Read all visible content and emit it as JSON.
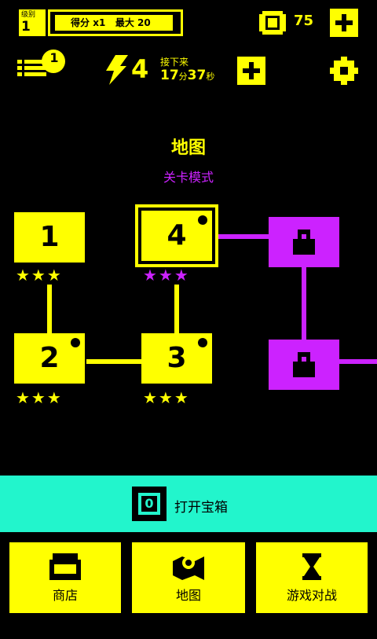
{
  "top": {
    "level_label": "级别",
    "level_value": "1",
    "score_label": "得分",
    "score_value": "x1",
    "max_label": "最大",
    "max_value": "20",
    "coins": "75"
  },
  "stack": {
    "badge": "1"
  },
  "energy": {
    "count": "4",
    "next_label": "接下来",
    "minutes": "17",
    "minutes_unit": "分",
    "seconds": "37",
    "seconds_unit": "秒"
  },
  "map": {
    "title": "地图",
    "mode": "关卡模式",
    "levels": [
      {
        "label": "1",
        "stars": "★★★"
      },
      {
        "label": "2",
        "stars": "★★★"
      },
      {
        "label": "3",
        "stars": "★★★"
      },
      {
        "label": "4",
        "stars": "★★★"
      }
    ]
  },
  "chest": {
    "label": "打开宝箱",
    "count": "0"
  },
  "nav": {
    "shop": "商店",
    "map": "地图",
    "battle": "游戏对战"
  },
  "colors": {
    "yellow": "#ffff00",
    "magenta": "#cc22ff",
    "teal": "#22f5cc",
    "bg": "#000000"
  }
}
